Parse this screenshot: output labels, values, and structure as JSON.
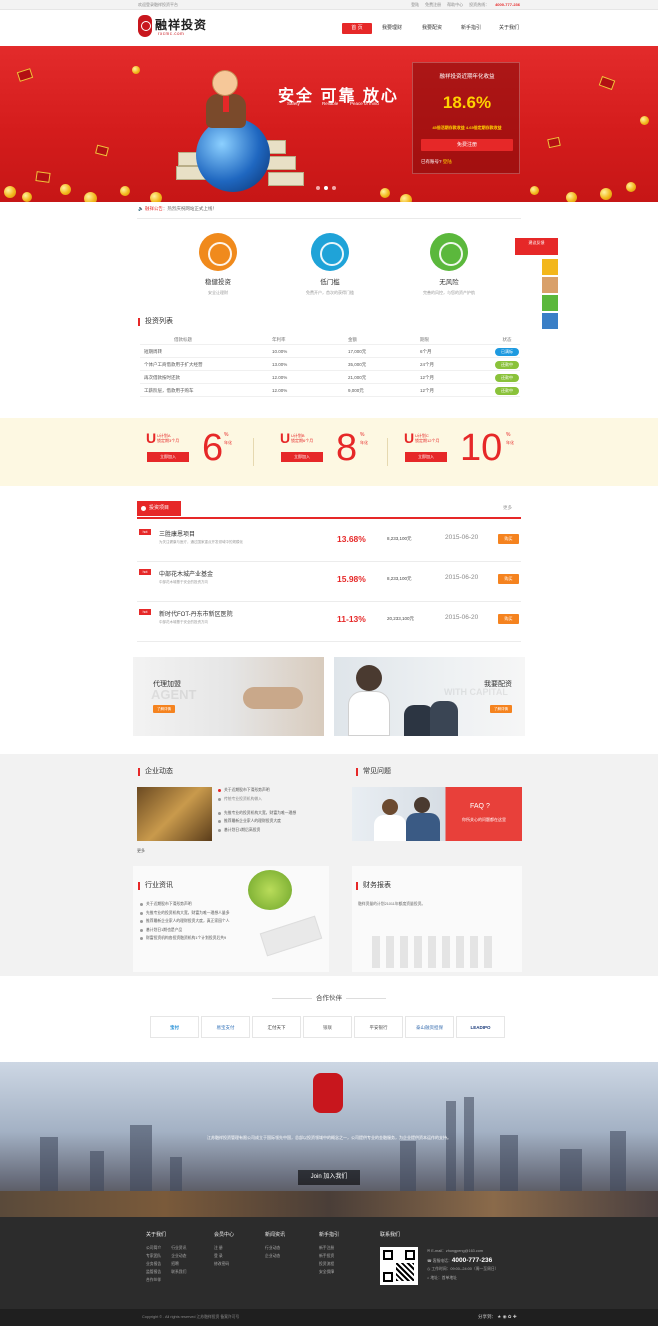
{
  "topbar": {
    "welcome": "欢迎登录融祥投资平台",
    "links": [
      "登陆",
      "免费注册",
      "帮助中心",
      "投资热线："
    ],
    "hotline": "4000-777-236"
  },
  "header": {
    "logo_text": "融祥投资",
    "logo_sub": "rxcmc.com",
    "nav": [
      "首 页",
      "我要理财",
      "我要配资",
      "新手指引",
      "关于我们"
    ]
  },
  "banner": {
    "slogan": "安全  可靠  放心",
    "slogan_sub": [
      "Safety",
      "Reliable",
      "Peace of mind"
    ],
    "yield_title": "融祥投资近期年化收益",
    "yield_rate": "18.6%",
    "yield_note_a": "45倍活期存款收益",
    "yield_note_b": "4.65倍定期存款收益",
    "register_btn": "免费注册",
    "have_account": "已有账号?",
    "login_link": "登陆"
  },
  "notice": {
    "label": "融祥公告",
    "text": "：热烈庆祝网站正式上线！"
  },
  "features": [
    {
      "title": "稳健投资",
      "desc": "安全让理财"
    },
    {
      "title": "低门槛",
      "desc": "免费开户，首次的获得门槛"
    },
    {
      "title": "无风险",
      "desc": "完善的风控，与您的资产护航"
    }
  ],
  "side_tool": {
    "label": "建议反馈"
  },
  "invest_list": {
    "title": "投资列表",
    "headers": [
      "借款标题",
      "年利率",
      "金额",
      "期限",
      "状态"
    ],
    "rows": [
      [
        "短期周转",
        "10.00%",
        "17,000元",
        "6个月",
        "已满标"
      ],
      [
        "个体户工商借款用于扩大经营",
        "13.00%",
        "35,000元",
        "24个月",
        "还款中"
      ],
      [
        "再次借款按时还款",
        "12.00%",
        "21,000元",
        "12个月",
        "还款中"
      ],
      [
        "工薪阶层，借款用于购车",
        "12.00%",
        "9,000元",
        "12个月",
        "还款中"
      ]
    ]
  },
  "products": [
    {
      "name": "U计划A",
      "sub": "锁定期3个月",
      "btn": "立即加入",
      "rate": "6",
      "unit": "%",
      "yr": "年化"
    },
    {
      "name": "U计划B",
      "sub": "锁定期6个月",
      "btn": "立即加入",
      "rate": "8",
      "unit": "%",
      "yr": "年化"
    },
    {
      "name": "U计划C",
      "sub": "锁定期12个月",
      "btn": "立即加入",
      "rate": "10",
      "unit": "%",
      "yr": "年化"
    }
  ],
  "projects": {
    "tab": "投资项目",
    "more": "更多",
    "items": [
      {
        "hot": "hot",
        "name": "三胜康恩项目",
        "desc": "为关注健康与医疗，通过国家重点开发领域中的规模化",
        "rate": "13.68%",
        "amount": "8,233,100元",
        "date": "2015-06-20",
        "btn": "购买"
      },
      {
        "hot": "hot",
        "name": "中部花木城产业基金",
        "desc": "中部花木城基于安全的投资方向",
        "rate": "15.98%",
        "amount": "8,233,100元",
        "date": "2015-06-20",
        "btn": "购买"
      },
      {
        "hot": "hot",
        "name": "新时代FOT-丹东市新区医院",
        "desc": "中部花木城基于安全的投资方向",
        "rate": "11-13%",
        "amount": "20,233,100元",
        "date": "2015-06-20",
        "btn": "购买"
      }
    ]
  },
  "ads": [
    {
      "title": "代理加盟",
      "bg": "AGENT",
      "btn": "了解详情"
    },
    {
      "title": "我要配资",
      "bg": "WITH CAPITAL",
      "btn": "了解详情"
    }
  ],
  "news": {
    "company_title": "企业动态",
    "company_items": [
      "关于近期股市下滑形势声明",
      "传统专业投资机构做入",
      "先推专业的投资机构大宽，财富为唯一理想",
      "推荐最新企业家人的理财投资大度",
      "基计划日1期后高投资"
    ],
    "company_more": "更多",
    "faq_title": "常见问题",
    "faq_q": "FAQ ?",
    "faq_sub": "你所关心的问题都在这里",
    "industry_title": "行业资讯",
    "industry_items": [
      "关于近期股市下滑形势声明",
      "先推专业的投资机构大宽，财富为唯一理想人量多",
      "推荐最新企业家人的理财投资大度，真正家园个人",
      "基计划日1期也是产品",
      "财富投资机构各投资融资机构1个计划投资后共9"
    ],
    "report_title": "财务报表",
    "report_text": "融祥资量的计划21011年额度资量投资。"
  },
  "partners": {
    "title": "合作伙伴",
    "logos": [
      "宝付",
      "易宝支付",
      "汇付天下",
      "银联",
      "平安银行",
      "泰山融资担保",
      "LEADIPO"
    ]
  },
  "city": {
    "text": "江苏融祥投资管理有限公司成立于国际领先中国，总部以投资领域中的概念之一，公司提供专业的金融服务，为企业提供资本运作的支持。",
    "join": "Join 加入我们"
  },
  "footer": {
    "cols": [
      {
        "title": "关于我们",
        "links": [
          "公司简介",
          "专家团队",
          "业务报告",
          "监管报告",
          "合作伙伴",
          "行业资讯",
          "企业动态",
          "招聘",
          "联系我们"
        ]
      },
      {
        "title": "会员中心",
        "links": [
          "注 册",
          "登 录",
          "修改密码"
        ]
      },
      {
        "title": "新闻资讯",
        "links": [
          "行业动态",
          "企业动态"
        ]
      },
      {
        "title": "新手指引",
        "links": [
          "新手注册",
          "新手投资",
          "投资流程",
          "安全保障"
        ]
      }
    ],
    "contact_title": "联系我们",
    "email_label": "E-mail",
    "email": "zhongpeng@163.com",
    "phone_label": "客服电话",
    "phone": "4000-777-236",
    "hours_label": "工作时间",
    "hours": "09:00--24:00（周一至周日）",
    "address_label": "地址",
    "address": "首单地址"
  },
  "copyright": {
    "text": "Copyright © . All rights reserved   江苏融祥投资   备案许可号",
    "share": "分享到："
  },
  "colors": {
    "brand": "#e62828",
    "orange": "#f5831f",
    "gold": "#ffd200"
  }
}
